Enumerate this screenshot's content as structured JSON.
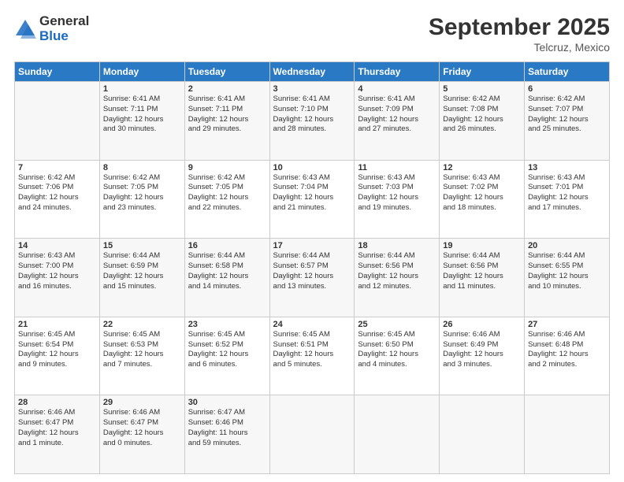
{
  "logo": {
    "general": "General",
    "blue": "Blue"
  },
  "header": {
    "month": "September 2025",
    "location": "Telcruz, Mexico"
  },
  "days_of_week": [
    "Sunday",
    "Monday",
    "Tuesday",
    "Wednesday",
    "Thursday",
    "Friday",
    "Saturday"
  ],
  "weeks": [
    [
      {
        "day": "",
        "info": ""
      },
      {
        "day": "1",
        "info": "Sunrise: 6:41 AM\nSunset: 7:11 PM\nDaylight: 12 hours\nand 30 minutes."
      },
      {
        "day": "2",
        "info": "Sunrise: 6:41 AM\nSunset: 7:11 PM\nDaylight: 12 hours\nand 29 minutes."
      },
      {
        "day": "3",
        "info": "Sunrise: 6:41 AM\nSunset: 7:10 PM\nDaylight: 12 hours\nand 28 minutes."
      },
      {
        "day": "4",
        "info": "Sunrise: 6:41 AM\nSunset: 7:09 PM\nDaylight: 12 hours\nand 27 minutes."
      },
      {
        "day": "5",
        "info": "Sunrise: 6:42 AM\nSunset: 7:08 PM\nDaylight: 12 hours\nand 26 minutes."
      },
      {
        "day": "6",
        "info": "Sunrise: 6:42 AM\nSunset: 7:07 PM\nDaylight: 12 hours\nand 25 minutes."
      }
    ],
    [
      {
        "day": "7",
        "info": "Sunrise: 6:42 AM\nSunset: 7:06 PM\nDaylight: 12 hours\nand 24 minutes."
      },
      {
        "day": "8",
        "info": "Sunrise: 6:42 AM\nSunset: 7:05 PM\nDaylight: 12 hours\nand 23 minutes."
      },
      {
        "day": "9",
        "info": "Sunrise: 6:42 AM\nSunset: 7:05 PM\nDaylight: 12 hours\nand 22 minutes."
      },
      {
        "day": "10",
        "info": "Sunrise: 6:43 AM\nSunset: 7:04 PM\nDaylight: 12 hours\nand 21 minutes."
      },
      {
        "day": "11",
        "info": "Sunrise: 6:43 AM\nSunset: 7:03 PM\nDaylight: 12 hours\nand 19 minutes."
      },
      {
        "day": "12",
        "info": "Sunrise: 6:43 AM\nSunset: 7:02 PM\nDaylight: 12 hours\nand 18 minutes."
      },
      {
        "day": "13",
        "info": "Sunrise: 6:43 AM\nSunset: 7:01 PM\nDaylight: 12 hours\nand 17 minutes."
      }
    ],
    [
      {
        "day": "14",
        "info": "Sunrise: 6:43 AM\nSunset: 7:00 PM\nDaylight: 12 hours\nand 16 minutes."
      },
      {
        "day": "15",
        "info": "Sunrise: 6:44 AM\nSunset: 6:59 PM\nDaylight: 12 hours\nand 15 minutes."
      },
      {
        "day": "16",
        "info": "Sunrise: 6:44 AM\nSunset: 6:58 PM\nDaylight: 12 hours\nand 14 minutes."
      },
      {
        "day": "17",
        "info": "Sunrise: 6:44 AM\nSunset: 6:57 PM\nDaylight: 12 hours\nand 13 minutes."
      },
      {
        "day": "18",
        "info": "Sunrise: 6:44 AM\nSunset: 6:56 PM\nDaylight: 12 hours\nand 12 minutes."
      },
      {
        "day": "19",
        "info": "Sunrise: 6:44 AM\nSunset: 6:56 PM\nDaylight: 12 hours\nand 11 minutes."
      },
      {
        "day": "20",
        "info": "Sunrise: 6:44 AM\nSunset: 6:55 PM\nDaylight: 12 hours\nand 10 minutes."
      }
    ],
    [
      {
        "day": "21",
        "info": "Sunrise: 6:45 AM\nSunset: 6:54 PM\nDaylight: 12 hours\nand 9 minutes."
      },
      {
        "day": "22",
        "info": "Sunrise: 6:45 AM\nSunset: 6:53 PM\nDaylight: 12 hours\nand 7 minutes."
      },
      {
        "day": "23",
        "info": "Sunrise: 6:45 AM\nSunset: 6:52 PM\nDaylight: 12 hours\nand 6 minutes."
      },
      {
        "day": "24",
        "info": "Sunrise: 6:45 AM\nSunset: 6:51 PM\nDaylight: 12 hours\nand 5 minutes."
      },
      {
        "day": "25",
        "info": "Sunrise: 6:45 AM\nSunset: 6:50 PM\nDaylight: 12 hours\nand 4 minutes."
      },
      {
        "day": "26",
        "info": "Sunrise: 6:46 AM\nSunset: 6:49 PM\nDaylight: 12 hours\nand 3 minutes."
      },
      {
        "day": "27",
        "info": "Sunrise: 6:46 AM\nSunset: 6:48 PM\nDaylight: 12 hours\nand 2 minutes."
      }
    ],
    [
      {
        "day": "28",
        "info": "Sunrise: 6:46 AM\nSunset: 6:47 PM\nDaylight: 12 hours\nand 1 minute."
      },
      {
        "day": "29",
        "info": "Sunrise: 6:46 AM\nSunset: 6:47 PM\nDaylight: 12 hours\nand 0 minutes."
      },
      {
        "day": "30",
        "info": "Sunrise: 6:47 AM\nSunset: 6:46 PM\nDaylight: 11 hours\nand 59 minutes."
      },
      {
        "day": "",
        "info": ""
      },
      {
        "day": "",
        "info": ""
      },
      {
        "day": "",
        "info": ""
      },
      {
        "day": "",
        "info": ""
      }
    ]
  ]
}
